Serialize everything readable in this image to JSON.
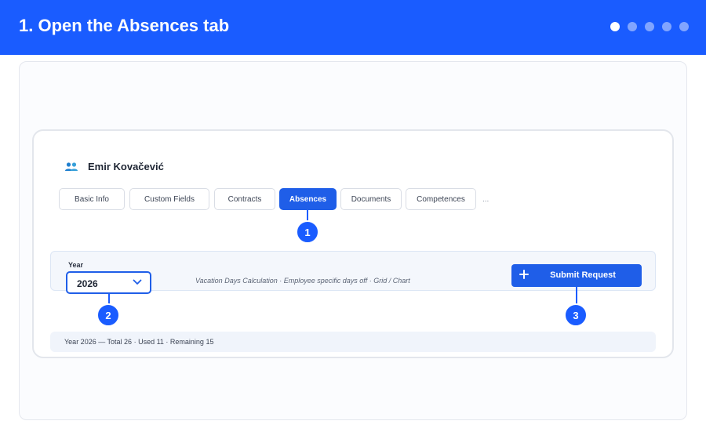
{
  "header": {
    "title": "1. Open the Absences tab",
    "progress_dots": [
      {
        "active": true
      },
      {
        "active": false
      },
      {
        "active": false
      },
      {
        "active": false
      },
      {
        "active": false
      }
    ]
  },
  "employee": {
    "name": "Emir Kovačević",
    "icon": "users-icon"
  },
  "tabs": [
    {
      "label": "Basic Info",
      "active": false
    },
    {
      "label": "Custom Fields",
      "active": false
    },
    {
      "label": "Contracts",
      "active": false
    },
    {
      "label": "Absences",
      "active": true
    },
    {
      "label": "Documents",
      "active": false
    },
    {
      "label": "Competences",
      "active": false
    }
  ],
  "tabs_more": "...",
  "toolbar": {
    "year_label": "Year",
    "year_value": "2026",
    "links": "Vacation Days Calculation · Employee specific days off · Grid / Chart",
    "submit_label": "Submit Request"
  },
  "summary": {
    "text": "Year 2026 — Total 26 · Used 11 · Remaining 15"
  },
  "steps": [
    "1",
    "2",
    "3"
  ],
  "colors": {
    "accent": "#1a5cff",
    "button": "#1f5ee8"
  }
}
